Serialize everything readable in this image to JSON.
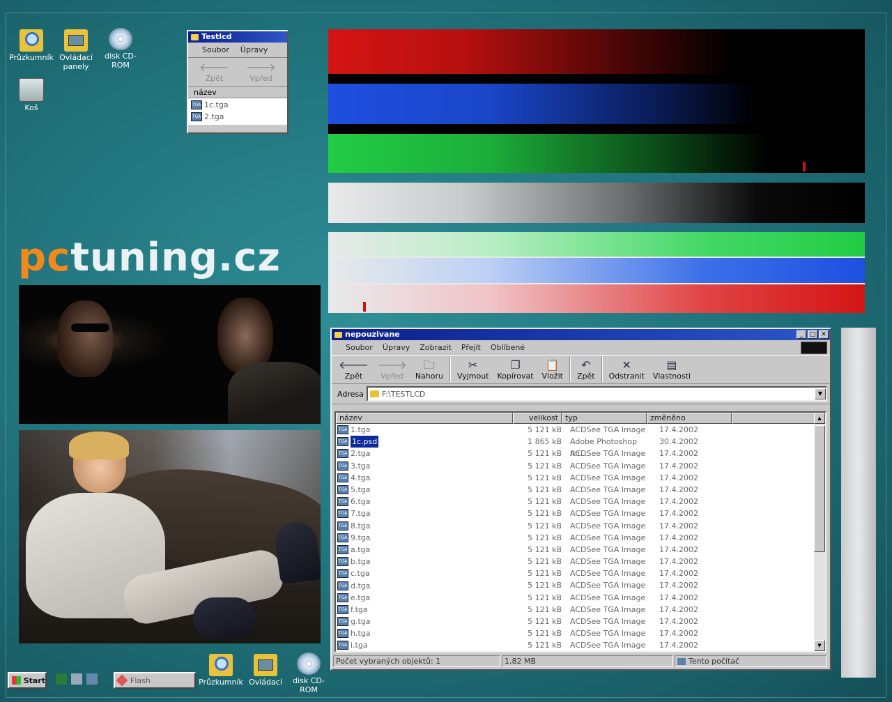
{
  "desktop": {
    "icons": [
      {
        "label": "Průzkumník",
        "icon": "explorer-icon"
      },
      {
        "label": "Ovládací panely",
        "icon": "control-panel-icon"
      },
      {
        "label": "disk CD-ROM",
        "icon": "cd-rom-icon"
      },
      {
        "label": "Koš",
        "icon": "recycle-bin-icon"
      }
    ],
    "logo_pc": "pc",
    "logo_rest": "tuning.cz"
  },
  "small_window": {
    "title": "Testlcd",
    "menu": [
      "Soubor",
      "Úpravy"
    ],
    "back_label": "Zpět",
    "forward_label": "Vpřed",
    "column_name": "název",
    "files": [
      "1c.tga",
      "2.tga"
    ]
  },
  "explorer": {
    "title": "nepouzivane",
    "menu": [
      "Soubor",
      "Úpravy",
      "Zobrazit",
      "Přejít",
      "Oblíbené"
    ],
    "toolbar": {
      "back": "Zpět",
      "forward": "Vpřed",
      "up": "Nahoru",
      "cut": "Vyjmout",
      "copy": "Kopírovat",
      "paste": "Vložit",
      "undo": "Zpět",
      "delete": "Odstranit",
      "properties": "Vlastnosti"
    },
    "address_label": "Adresa",
    "address_value": "F:\\TESTLCD",
    "columns": {
      "name": "název",
      "size": "velikost",
      "type": "typ",
      "modified": "změněno"
    },
    "files": [
      {
        "name": "1.tga",
        "size": "5 121 kB",
        "type": "ACDSee TGA Image",
        "date": "17.4.2002"
      },
      {
        "name": "1c.psd",
        "size": "1 865 kB",
        "type": "Adobe Photoshop Im...",
        "date": "30.4.2002"
      },
      {
        "name": "2.tga",
        "size": "5 121 kB",
        "type": "ACDSee TGA Image",
        "date": "17.4.2002"
      },
      {
        "name": "3.tga",
        "size": "5 121 kB",
        "type": "ACDSee TGA Image",
        "date": "17.4.2002"
      },
      {
        "name": "4.tga",
        "size": "5 121 kB",
        "type": "ACDSee TGA Image",
        "date": "17.4.2002"
      },
      {
        "name": "5.tga",
        "size": "5 121 kB",
        "type": "ACDSee TGA Image",
        "date": "17.4.2002"
      },
      {
        "name": "6.tga",
        "size": "5 121 kB",
        "type": "ACDSee TGA Image",
        "date": "17.4.2002"
      },
      {
        "name": "7.tga",
        "size": "5 121 kB",
        "type": "ACDSee TGA Image",
        "date": "17.4.2002"
      },
      {
        "name": "8.tga",
        "size": "5 121 kB",
        "type": "ACDSee TGA Image",
        "date": "17.4.2002"
      },
      {
        "name": "9.tga",
        "size": "5 121 kB",
        "type": "ACDSee TGA Image",
        "date": "17.4.2002"
      },
      {
        "name": "a.tga",
        "size": "5 121 kB",
        "type": "ACDSee TGA Image",
        "date": "17.4.2002"
      },
      {
        "name": "b.tga",
        "size": "5 121 kB",
        "type": "ACDSee TGA Image",
        "date": "17.4.2002"
      },
      {
        "name": "c.tga",
        "size": "5 121 kB",
        "type": "ACDSee TGA Image",
        "date": "17.4.2002"
      },
      {
        "name": "d.tga",
        "size": "5 121 kB",
        "type": "ACDSee TGA Image",
        "date": "17.4.2002"
      },
      {
        "name": "e.tga",
        "size": "5 121 kB",
        "type": "ACDSee TGA Image",
        "date": "17.4.2002"
      },
      {
        "name": "f.tga",
        "size": "5 121 kB",
        "type": "ACDSee TGA Image",
        "date": "17.4.2002"
      },
      {
        "name": "g.tga",
        "size": "5 121 kB",
        "type": "ACDSee TGA Image",
        "date": "17.4.2002"
      },
      {
        "name": "h.tga",
        "size": "5 121 kB",
        "type": "ACDSee TGA Image",
        "date": "17.4.2002"
      },
      {
        "name": "i.tga",
        "size": "5 121 kB",
        "type": "ACDSee TGA Image",
        "date": "17.4.2002"
      }
    ],
    "selected_file": "1c.psd",
    "status": {
      "selected": "Počet vybraných objektů: 1",
      "size": "1,82 MB",
      "location": "Tento počítač"
    }
  },
  "taskbar": {
    "start": "Start",
    "task": "Flash",
    "quick_icons": [
      {
        "label": "Průzkumník",
        "icon": "explorer-icon"
      },
      {
        "label": "Ovládací",
        "icon": "control-panel-icon"
      },
      {
        "label": "disk CD-ROM",
        "icon": "cd-rom-icon"
      }
    ]
  },
  "colors": {
    "desktop": "#1f6f78",
    "title_active": "#0b1f8c",
    "logo_orange": "#f08a1c",
    "bar_red": "#d41414",
    "bar_blue": "#1f4fe0",
    "bar_green": "#22cc44"
  }
}
